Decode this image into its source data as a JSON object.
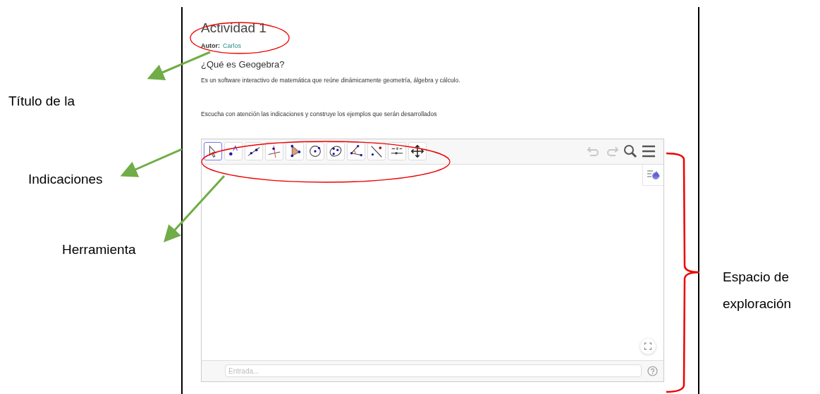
{
  "page": {
    "title": "Actividad 1",
    "author_label": "Autor:",
    "author": "Carlos",
    "heading": "¿Qué es Geogebra?",
    "paragraphs": [
      "Es un software interactivo de matemática que reúne dinámicamente geometría, álgebra y cálculo.",
      "Escucha con atención las indicaciones y construye los ejemplos que serán desarrollados"
    ]
  },
  "applet": {
    "tools": [
      {
        "kind": "move",
        "selected": true
      },
      {
        "kind": "point",
        "selected": false
      },
      {
        "kind": "line",
        "selected": false
      },
      {
        "kind": "perpendicular",
        "selected": false
      },
      {
        "kind": "polygon",
        "selected": false
      },
      {
        "kind": "circle",
        "selected": false
      },
      {
        "kind": "conic",
        "selected": false
      },
      {
        "kind": "angle",
        "selected": false
      },
      {
        "kind": "reflect",
        "selected": false
      },
      {
        "kind": "slider",
        "selected": false
      },
      {
        "kind": "pan",
        "selected": false
      }
    ],
    "undo": {
      "disabled": true
    },
    "redo": {
      "disabled": true
    },
    "input": {
      "placeholder": "Entrada..."
    }
  },
  "annotations": [
    "Título de la",
    "Indicaciones",
    "Herramienta",
    "Espacio de exploración"
  ]
}
